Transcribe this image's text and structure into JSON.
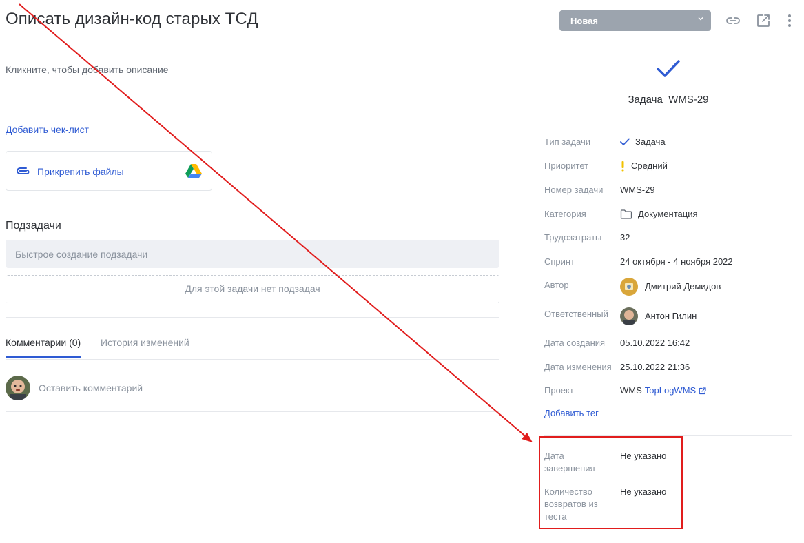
{
  "header": {
    "title": "Описать дизайн-код старых ТСД",
    "status_label": "Новая",
    "status_chevron": "⌄",
    "icons": [
      "link-icon",
      "external-link-icon",
      "more-vertical-icon"
    ]
  },
  "main": {
    "description_placeholder": "Кликните, чтобы добавить описание",
    "add_checklist": "Добавить чек-лист",
    "attach_files": "Прикрепить файлы",
    "subtasks_title": "Подзадачи",
    "quick_subtask_placeholder": "Быстрое создание подзадачи",
    "no_subtasks": "Для этой задачи нет подзадач",
    "tabs": [
      {
        "label": "Комментарии (0)",
        "active": true
      },
      {
        "label": "История изменений",
        "active": false
      }
    ],
    "comment_placeholder": "Оставить комментарий"
  },
  "side": {
    "task_type_title": "Задача  WMS-29",
    "props": {
      "type": {
        "label": "Тип задачи",
        "value": "Задача"
      },
      "priority": {
        "label": "Приоритет",
        "value": "Средний"
      },
      "number": {
        "label": "Номер задачи",
        "value": "WMS-29"
      },
      "category": {
        "label": "Категория",
        "value": "Документация"
      },
      "effort": {
        "label": "Трудозатраты",
        "value": "32"
      },
      "sprint": {
        "label": "Спринт",
        "value": "24 октября - 4 ноября 2022"
      },
      "author": {
        "label": "Автор",
        "value": "Дмитрий Демидов"
      },
      "assignee": {
        "label": "Ответственный",
        "value": "Антон Гилин"
      },
      "created": {
        "label": "Дата создания",
        "value": "05.10.2022 16:42"
      },
      "modified": {
        "label": "Дата изменения",
        "value": "25.10.2022 21:36"
      },
      "project": {
        "label": "Проект",
        "prefix": "WMS",
        "value": "TopLogWMS"
      }
    },
    "add_tag": "Добавить тег",
    "extra": {
      "due": {
        "label_line1": "Дата",
        "label_line2": "завершения",
        "value": "Не указано"
      },
      "returns": {
        "label_line1": "Количество",
        "label_line2": "возвратов из",
        "label_line3": "теста",
        "value": "Не указано"
      }
    }
  },
  "colors": {
    "accent": "#2f5bd3",
    "status_bg": "#9ca4ae",
    "annotation_red": "#e11d1d",
    "priority_yellow": "#f2c200"
  }
}
